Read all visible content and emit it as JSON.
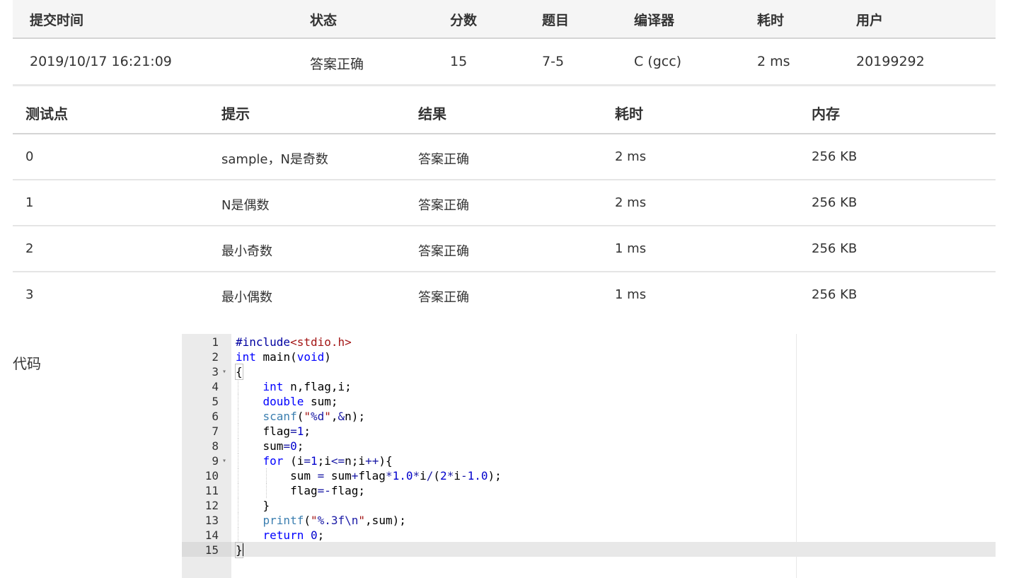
{
  "submission": {
    "headers": [
      "提交时间",
      "状态",
      "分数",
      "题目",
      "编译器",
      "耗时",
      "用户"
    ],
    "row": {
      "time": "2019/10/17 16:21:09",
      "status": "答案正确",
      "score": "15",
      "problem": "7-5",
      "compiler": "C (gcc)",
      "elapsed": "2 ms",
      "user": "20199292"
    }
  },
  "tests": {
    "headers": [
      "测试点",
      "提示",
      "结果",
      "耗时",
      "内存"
    ],
    "rows": [
      {
        "id": "0",
        "hint": "sample，N是奇数",
        "result": "答案正确",
        "time": "2 ms",
        "memory": "256 KB"
      },
      {
        "id": "1",
        "hint": "N是偶数",
        "result": "答案正确",
        "time": "2 ms",
        "memory": "256 KB"
      },
      {
        "id": "2",
        "hint": "最小奇数",
        "result": "答案正确",
        "time": "1 ms",
        "memory": "256 KB"
      },
      {
        "id": "3",
        "hint": "最小偶数",
        "result": "答案正确",
        "time": "1 ms",
        "memory": "256 KB"
      }
    ]
  },
  "code": {
    "label": "代码",
    "lines": [
      "#include<stdio.h>",
      "int main(void)",
      "{",
      "    int n,flag,i;",
      "    double sum;",
      "    scanf(\"%d\",&n);",
      "    flag=1;",
      "    sum=0;",
      "    for (i=1;i<=n;i++){",
      "        sum = sum+flag*1.0*i/(2*i-1.0);",
      "        flag=-flag;",
      "    }",
      "    printf(\"%.3f\\n\",sum);",
      "    return 0;",
      "}"
    ]
  },
  "colors": {
    "success": "#e74c3c",
    "link": "#1b5fa8",
    "header_bg": "#f5f5f5"
  }
}
